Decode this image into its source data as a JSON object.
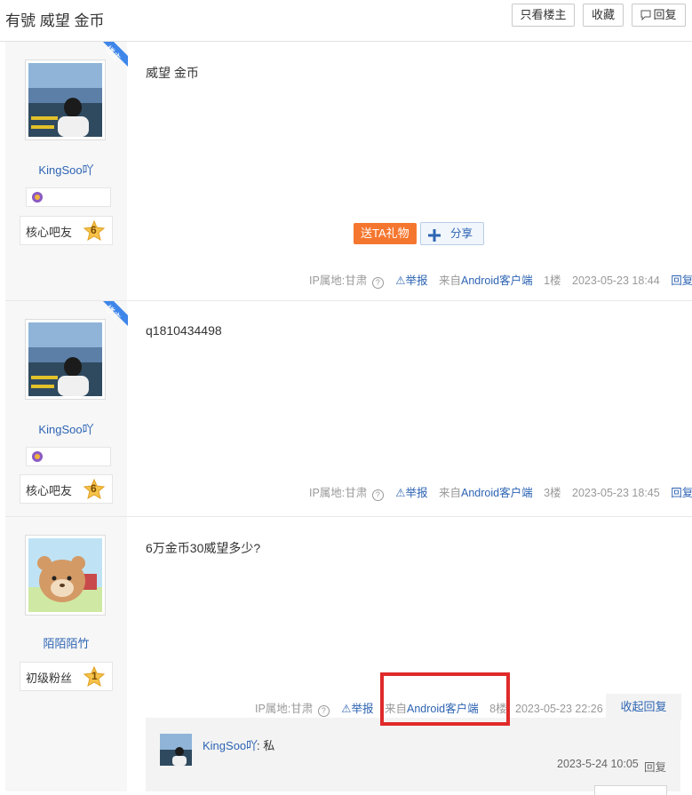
{
  "header": {
    "title": "有號 威望 金币",
    "only_owner": "只看楼主",
    "favorite": "收藏",
    "reply": "回复"
  },
  "posts": [
    {
      "username": "KingSoo吖",
      "ribbon": "楼主",
      "level_label": "核心吧友",
      "level_num": "6",
      "content": "威望 金币",
      "gift_label": "送TA礼物",
      "share_label": "分享",
      "ip": "IP属地:甘肃",
      "report": "举报",
      "from_prefix": "来自",
      "from_client": "Android客户端",
      "floor": "1楼",
      "time": "2023-05-23 18:44",
      "reply": "回复"
    },
    {
      "username": "KingSoo吖",
      "ribbon": "楼主",
      "level_label": "核心吧友",
      "level_num": "6",
      "content": "q1810434498",
      "ip": "IP属地:甘肃",
      "report": "举报",
      "from_prefix": "来自",
      "from_client": "Android客户端",
      "floor": "3楼",
      "time": "2023-05-23 18:45",
      "reply": "回复"
    },
    {
      "username": "陌陌陌竹",
      "level_label": "初级粉丝",
      "level_num": "1",
      "content": "6万金币30威望多少?",
      "ip": "IP属地:甘肃",
      "report": "举报",
      "from_prefix": "来自",
      "from_client": "Android客户端",
      "floor": "8楼",
      "time": "2023-05-23 22:26",
      "collapse": "收起回复"
    }
  ],
  "sub_reply": {
    "username": "KingSoo吖",
    "text": ": 私",
    "time": "2023-5-24 10:05",
    "reply": "回复"
  },
  "colors": {
    "link": "#2d64b3",
    "gift": "#f5772f",
    "ribbon": "#3f86ea",
    "highlight": "#e02a2a"
  }
}
